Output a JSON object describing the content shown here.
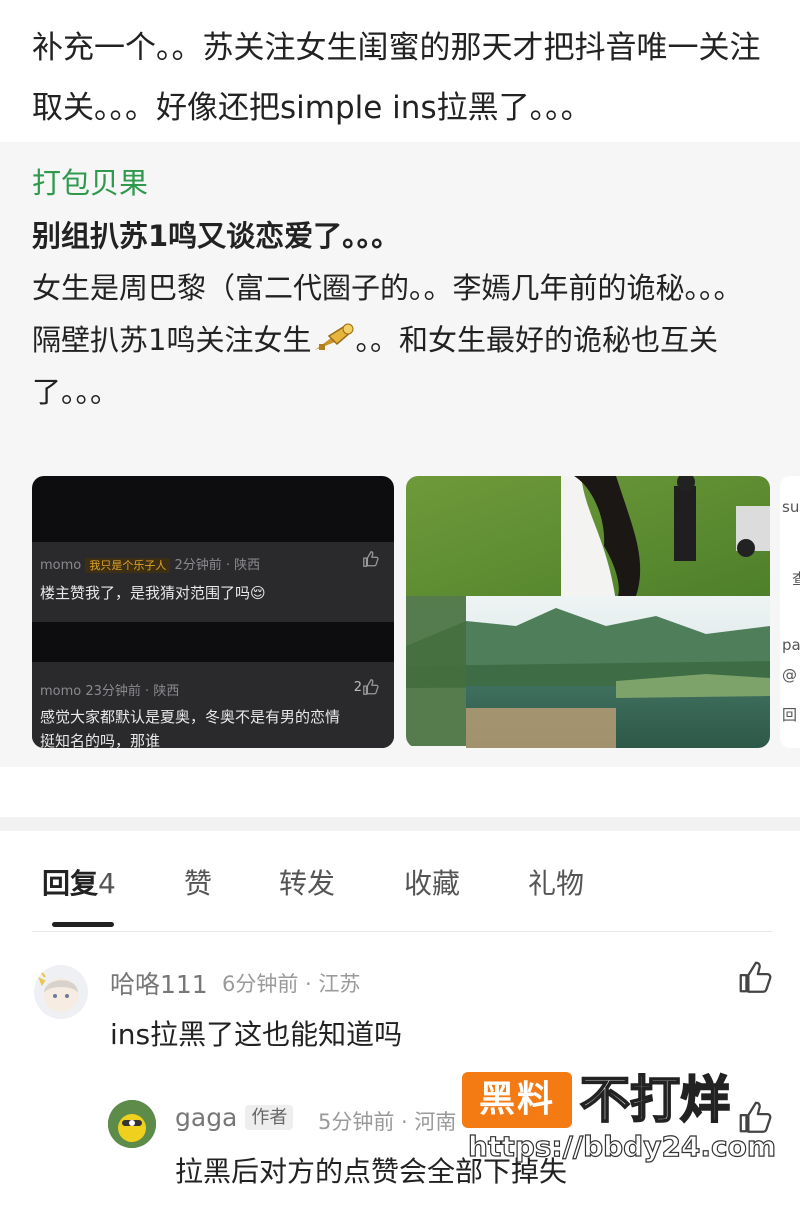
{
  "post": {
    "text": "补充一个。。苏关注女生闺蜜的那天才把抖音唯一关注取关。。。好像还把simple ins拉黑了。。。"
  },
  "quote": {
    "author": "打包贝果",
    "line1": "别组扒苏1鸣又谈恋爱了。。。",
    "line2": "女生是周巴黎（富二代圈子的。。李嫣几年前的诡秘。。。",
    "line3a": "隔壁扒苏1鸣关注女生",
    "line3b": "。。和女生最好的诡秘也互关了。。。"
  },
  "screenshot_comments": [
    {
      "user": "momo",
      "tag": "我只是个乐子人",
      "meta": "2分钟前 · 陕西",
      "likes": "",
      "text": "楼主赞我了，是我猜对范围了吗😌"
    },
    {
      "user": "momo",
      "tag": "",
      "meta": "23分钟前 · 陕西",
      "likes": "2",
      "text1": "感觉大家都默认是夏奥，冬奥不是有男的恋情",
      "text2": "挺知名的吗，那谁"
    }
  ],
  "peek": {
    "t1": "su",
    "t2": "查",
    "t3": "pa",
    "t4": "@",
    "t5": "回"
  },
  "tabs": [
    {
      "label": "回复",
      "count": "4"
    },
    {
      "label": "赞"
    },
    {
      "label": "转发"
    },
    {
      "label": "收藏"
    },
    {
      "label": "礼物"
    }
  ],
  "replies": [
    {
      "user": "哈咯111",
      "meta": "6分钟前 · 江苏",
      "text": "ins拉黑了这也能知道吗"
    },
    {
      "user": "gaga",
      "badge": "作者",
      "meta": "5分钟前 · 河南",
      "text": "拉黑后对方的点赞会全部下掉失"
    }
  ],
  "watermark": {
    "box": "黑料",
    "right": "不打烊",
    "url": "https://bbdy24.com"
  },
  "colors": {
    "author_green": "#2f9a4e",
    "watermark_orange": "#f47a14"
  }
}
